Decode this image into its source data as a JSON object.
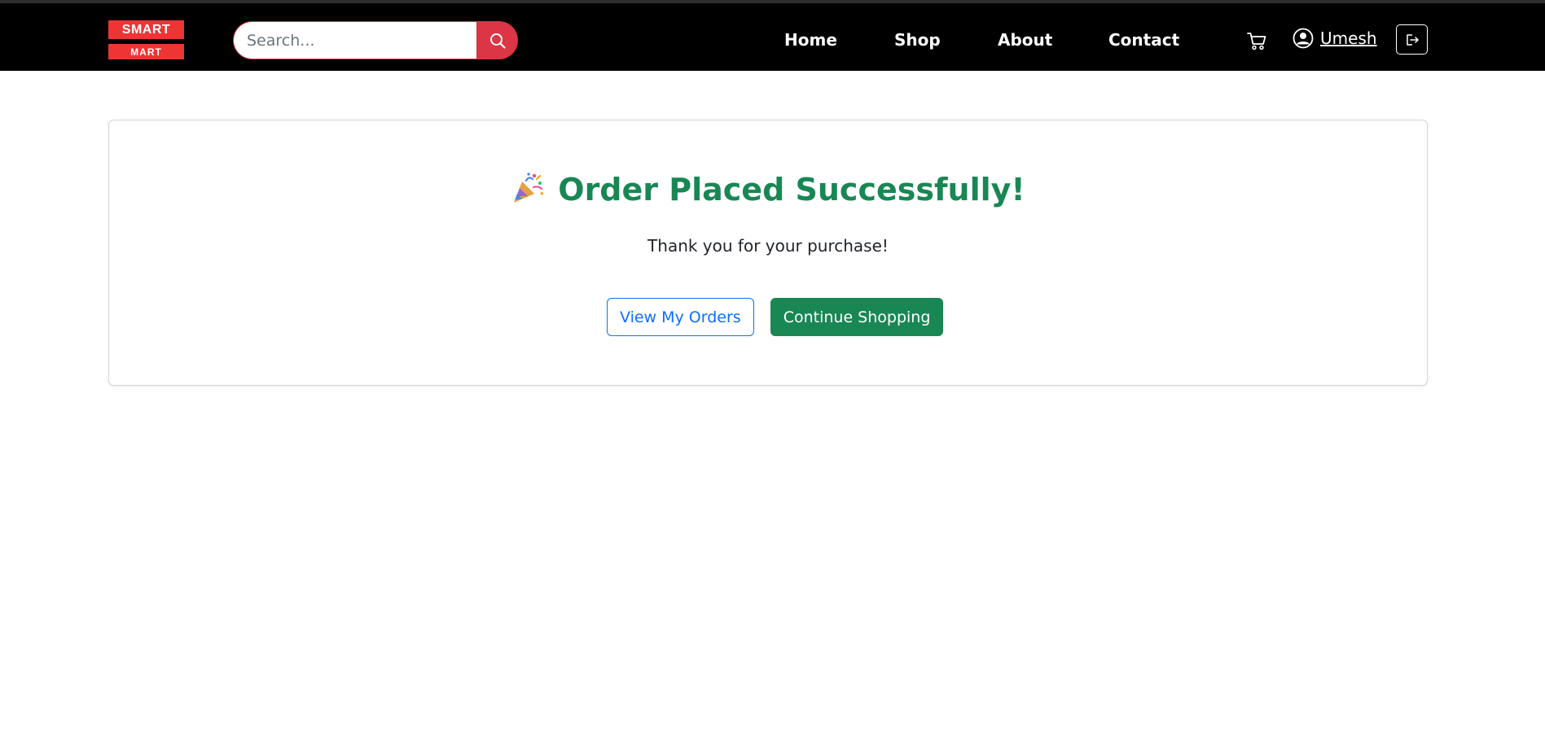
{
  "brand": {
    "logo_top": "SMART",
    "logo_bottom": "MART",
    "accent": "#ef3434"
  },
  "search": {
    "placeholder": "Search...",
    "icon": "search-icon"
  },
  "nav": {
    "items": [
      {
        "label": "Home"
      },
      {
        "label": "Shop"
      },
      {
        "label": "About"
      },
      {
        "label": "Contact"
      }
    ]
  },
  "header_actions": {
    "cart_icon": "cart-icon",
    "user_icon": "user-circle-icon",
    "user_name": "Umesh",
    "logout_icon": "logout-icon"
  },
  "confirmation": {
    "icon": "party-popper-icon",
    "title": "Order Placed Successfully!",
    "message": "Thank you for your purchase!",
    "primary_color": "#198754"
  },
  "actions": {
    "view_orders_label": "View My Orders",
    "continue_label": "Continue Shopping",
    "outline_color": "#0d6efd"
  }
}
